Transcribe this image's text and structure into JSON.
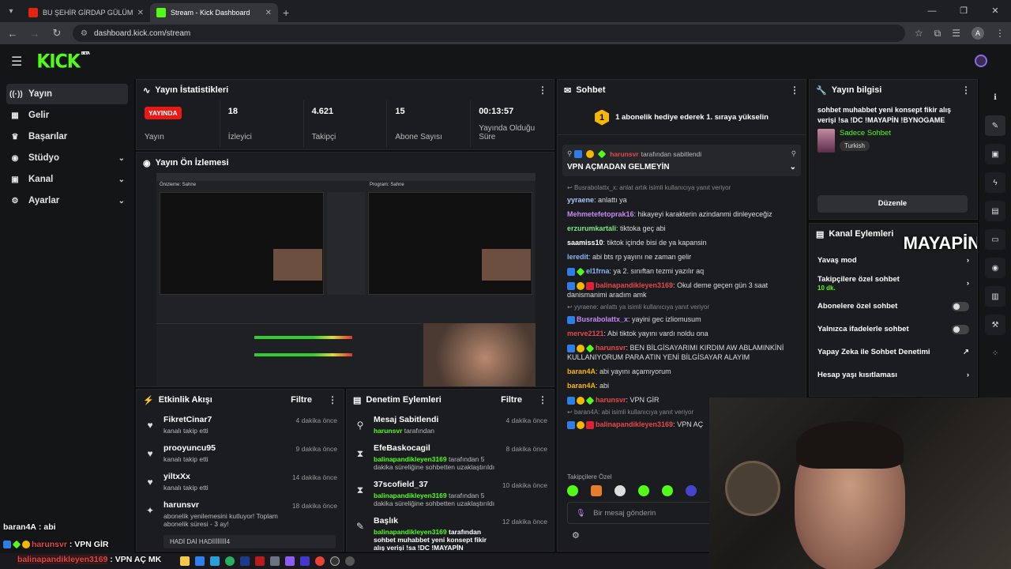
{
  "browser": {
    "tabs": [
      {
        "title": "BU ŞEHİR GİRDAP GÜLÜM / YÜ",
        "active": false,
        "favicon_color": "#e62117"
      },
      {
        "title": "Stream - Kick Dashboard",
        "active": true,
        "favicon_color": "#53fc18"
      }
    ],
    "url": "dashboard.kick.com/stream",
    "profile_initial": "A"
  },
  "header": {
    "logo": "KICK",
    "beta": "BETA"
  },
  "sidebar": {
    "items": [
      {
        "label": "Yayın",
        "icon": "broadcast-icon",
        "active": true,
        "glyph": "((·))"
      },
      {
        "label": "Gelir",
        "icon": "revenue-icon",
        "glyph": "▦"
      },
      {
        "label": "Başarılar",
        "icon": "trophy-icon",
        "glyph": "🏆"
      },
      {
        "label": "Stüdyo",
        "icon": "studio-icon",
        "glyph": "◉",
        "chevron": true
      },
      {
        "label": "Kanal",
        "icon": "channel-icon",
        "glyph": "▣",
        "chevron": true
      },
      {
        "label": "Ayarlar",
        "icon": "settings-icon",
        "glyph": "⚙",
        "chevron": true
      }
    ]
  },
  "stats": {
    "title": "Yayın İstatistikleri",
    "live_badge": "YAYINDA",
    "live_label": "Yayın",
    "items": [
      {
        "value": "18",
        "label": "İzleyici"
      },
      {
        "value": "4.621",
        "label": "Takipçi"
      },
      {
        "value": "15",
        "label": "Abone Sayısı"
      },
      {
        "value": "00:13:57",
        "label": "Yayında Olduğu Süre"
      }
    ]
  },
  "preview": {
    "title": "Yayın Ön İzlemesi",
    "obs_left": "Önizleme: Sahne",
    "obs_right": "Program: Sahne"
  },
  "activity": {
    "title": "Etkinlik Akışı",
    "filter": "Filtre",
    "items": [
      {
        "name": "FikretCinar7",
        "desc": "kanalı takip etti",
        "time": "4 dakika önce",
        "icon": "heart-icon",
        "glyph": "♥"
      },
      {
        "name": "prooyuncu95",
        "desc": "kanalı takip etti",
        "time": "9 dakika önce",
        "icon": "heart-icon",
        "glyph": "♥"
      },
      {
        "name": "yiltxXx",
        "desc": "kanalı takip etti",
        "time": "14 dakika önce",
        "icon": "heart-icon",
        "glyph": "♥"
      },
      {
        "name": "harunsvr",
        "desc": "abonelik yenilemesini kutluyor! Toplam abonelik süresi - 3 ay!",
        "time": "18 dakika önce",
        "icon": "star-icon",
        "glyph": "✦"
      }
    ],
    "last_message": "HADİ DAİ HADİİİİİİİİ4"
  },
  "moderation": {
    "title": "Denetim Eylemleri",
    "filter": "Filtre",
    "items": [
      {
        "name": "Mesaj Sabitlendi",
        "user": "harunsvr",
        "rest": "tarafından",
        "time": "4 dakika önce",
        "icon": "pin-icon",
        "glyph": "📌"
      },
      {
        "name": "EfeBaskocagil",
        "user": "balinapandikleyen3169",
        "rest": "tarafından 5 dakika süreliğine sohbetten uzaklaştırıldı",
        "time": "8 dakika önce",
        "icon": "hourglass-icon",
        "glyph": "⧗"
      },
      {
        "name": "37scofield_37",
        "user": "balinapandikleyen3169",
        "rest": "tarafından 5 dakika süreliğine sohbetten uzaklaştırıldı",
        "time": "10 dakika önce",
        "icon": "hourglass-icon",
        "glyph": "⧗"
      },
      {
        "name": "Başlık",
        "user": "balinapandikleyen3169",
        "rest": "tarafından sohbet muhabbet yeni konsept fikir alış verişi !sa !DC !MAYAPİN !BYNOGAME",
        "time": "12 dakika önce",
        "icon": "title-edit-icon",
        "glyph": "✎"
      }
    ]
  },
  "chat": {
    "title": "Sohbet",
    "goal": "1 abonelik hediye ederek 1. sıraya yükselin",
    "pinned_by": "harunsvr",
    "pinned_suffix": "tarafından sabitlendi",
    "pinned_text": "VPN AÇMADAN GELMEYİN",
    "messages": [
      {
        "reply": "Busrabolattx_x: anlat artık isimli kullanıcıya yanıt veriyor"
      },
      {
        "user": "yyraene",
        "color": "#a8c7fa",
        "text": "anlattı ya"
      },
      {
        "user": "Mehmetefetoprak16",
        "color": "#c58af9",
        "text": "hikayeyi karakterin azindanmi dinleyeceğiz"
      },
      {
        "user": "erzurumkartali",
        "color": "#7ee787",
        "text": "tiktoka geç abi"
      },
      {
        "user": "saamiss10",
        "color": "#ffffff",
        "text": "tiktok içinde bisi de ya kapansin"
      },
      {
        "user": "leredit",
        "color": "#8ab4f8",
        "text": "abi bts rp yayını ne zaman gelir"
      },
      {
        "user": "el1frna",
        "color": "#8ab4f8",
        "text": "ya 2. sınıftan tezmi yazılır aq",
        "badges": [
          "b-blue",
          "b-green"
        ]
      },
      {
        "user": "balinapandikleyen3169",
        "color": "#e5484d",
        "text": "Okul deme geçen gün 3 saat danismanimi aradım amk",
        "badges": [
          "b-blue",
          "b-gold",
          "b-red"
        ]
      },
      {
        "reply": "yyraene: anlattı ya isimli kullanıcıya yanıt veriyor"
      },
      {
        "user": "Busrabolattx_x",
        "color": "#c58af9",
        "text": "yayini gec izliomusum",
        "badges": [
          "b-blue"
        ]
      },
      {
        "user": "merve2121",
        "color": "#e5484d",
        "text": "Abi tiktok yayını vardı noldu ona"
      },
      {
        "user": "harunsvr",
        "color": "#e5484d",
        "text": "BEN BİLGİSAYARIMI KIRDIM AW ABLAMINKİNİ KULLANIYORUM PARA ATIN YENİ BİLGİSAYAR ALAYIM",
        "badges": [
          "b-blue",
          "b-gold",
          "b-green"
        ]
      },
      {
        "user": "baran4A",
        "color": "#f5b700",
        "text": "abi yayını açamıyorum"
      },
      {
        "user": "baran4A",
        "color": "#f5b700",
        "text": "abi"
      },
      {
        "user": "harunsvr",
        "color": "#e5484d",
        "text": "VPN GİR",
        "badges": [
          "b-blue",
          "b-gold",
          "b-green"
        ]
      },
      {
        "reply": "baran4A: abi isimli kullanıcıya yanıt veriyor"
      },
      {
        "user": "balinapandikleyen3169",
        "color": "#e5484d",
        "text": "VPN AÇ",
        "badges": [
          "b-blue",
          "b-gold",
          "b-red"
        ]
      }
    ],
    "emote_label": "Takipçilere Özel",
    "placeholder": "Bir mesaj gönderin"
  },
  "stream_info": {
    "title": "Yayın bilgisi",
    "stream_title": "sohbet muhabbet yeni konsept fikir alış verişi !sa !DC !MAYAPİN !BYNOGAME",
    "category": "Sadece Sohbet",
    "language": "Turkish",
    "edit": "Düzenle"
  },
  "channel_actions": {
    "title": "Kanal Eylemleri",
    "watermark": "MAYAPİN",
    "items": [
      {
        "label": "Yavaş mod",
        "control": "chevron"
      },
      {
        "label": "Takipçilere özel sohbet",
        "sub": "10 dk.",
        "control": "chevron"
      },
      {
        "label": "Abonelere özel sohbet",
        "control": "toggle"
      },
      {
        "label": "Yalnızca ifadelerle sohbet",
        "control": "toggle"
      },
      {
        "label": "Yapay Zeka ile Sohbet Denetimi",
        "control": "external"
      },
      {
        "label": "Hesap yaşı kısıtlaması",
        "control": "chevron"
      }
    ]
  },
  "overlay": {
    "lines": [
      {
        "user": "baran4A",
        "text": "abi"
      },
      {
        "user": "harunsvr",
        "text": "VPN GİR"
      },
      {
        "user": "balinapandikleyen3169",
        "text": "VPN AÇ MK"
      }
    ]
  }
}
